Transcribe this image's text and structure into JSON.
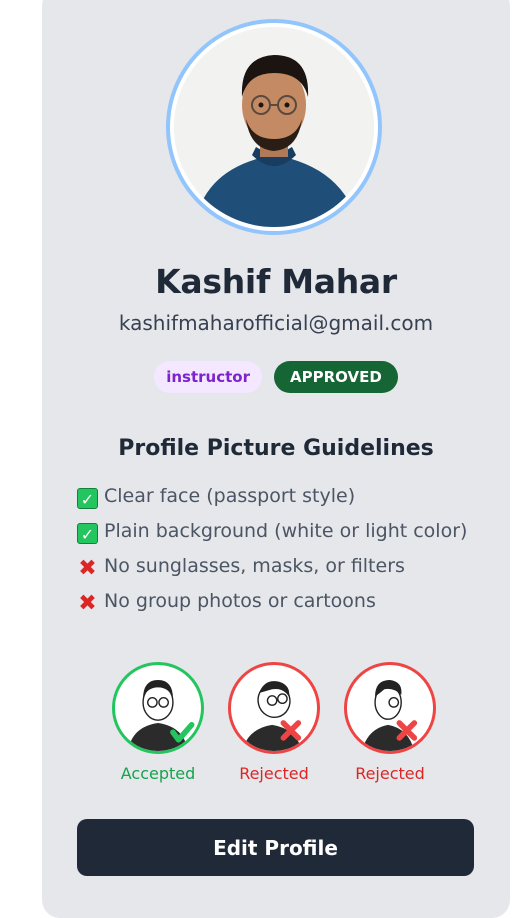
{
  "profile": {
    "name": "Kashif Mahar",
    "email": "kashifmaharofficial@gmail.com",
    "role_badge": "instructor",
    "status_badge": "APPROVED"
  },
  "guidelines": {
    "title": "Profile Picture Guidelines",
    "items": [
      {
        "icon": "check-mark-icon",
        "text": "Clear face (passport style)"
      },
      {
        "icon": "check-mark-icon",
        "text": "Plain background (white or light color)"
      },
      {
        "icon": "cross-mark-icon",
        "text": "No sunglasses, masks, or filters"
      },
      {
        "icon": "cross-mark-icon",
        "text": "No group photos or cartoons"
      }
    ]
  },
  "samples": [
    {
      "label": "Accepted",
      "status": "accepted"
    },
    {
      "label": "Rejected",
      "status": "rejected"
    },
    {
      "label": "Rejected",
      "status": "rejected"
    }
  ],
  "actions": {
    "edit_profile": "Edit Profile"
  },
  "colors": {
    "card_bg": "#e5e7eb",
    "avatar_ring": "#93c5fd",
    "approved": "#166534",
    "role_badge_bg": "#f3e8ff",
    "role_badge_text": "#7e22ce",
    "accepted": "#22c55e",
    "rejected": "#ef4444",
    "button_bg": "#1f2937"
  }
}
